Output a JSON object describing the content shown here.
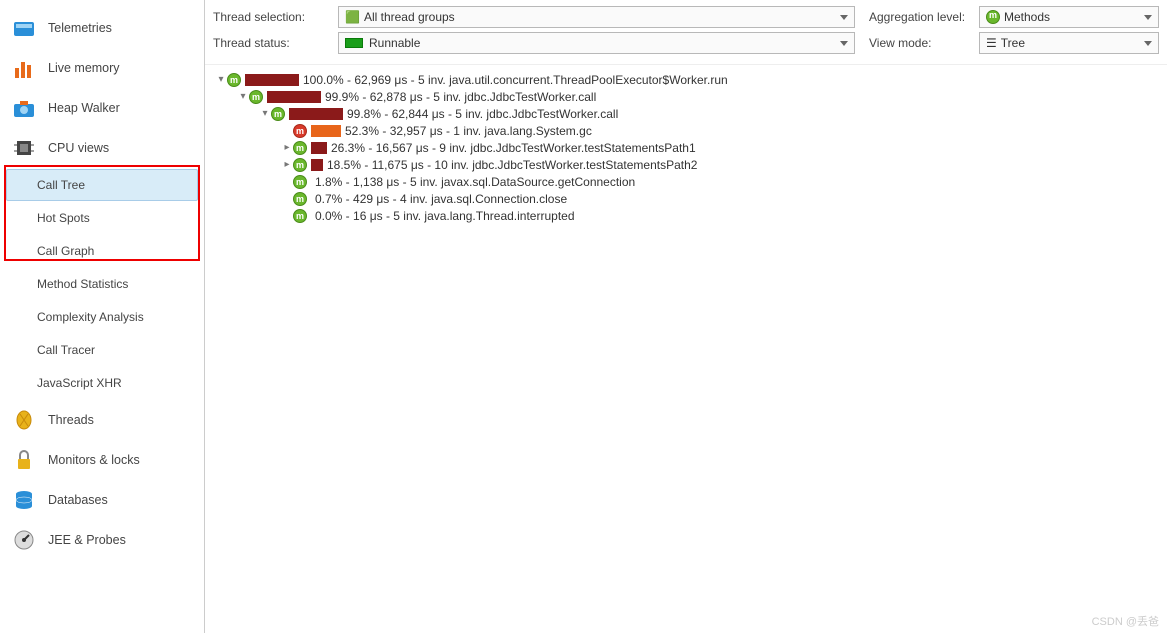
{
  "sidebar": {
    "items": [
      {
        "label": "Telemetries"
      },
      {
        "label": "Live memory"
      },
      {
        "label": "Heap Walker"
      },
      {
        "label": "CPU views"
      },
      {
        "label": "Threads"
      },
      {
        "label": "Monitors & locks"
      },
      {
        "label": "Databases"
      },
      {
        "label": "JEE & Probes"
      }
    ],
    "cpu_sub": [
      {
        "label": "Call Tree",
        "selected": true
      },
      {
        "label": "Hot Spots"
      },
      {
        "label": "Call Graph"
      },
      {
        "label": "Method Statistics"
      },
      {
        "label": "Complexity Analysis"
      },
      {
        "label": "Call Tracer"
      },
      {
        "label": "JavaScript XHR"
      }
    ]
  },
  "filters": {
    "thread_selection_label": "Thread selection:",
    "thread_selection_value": "All thread groups",
    "thread_status_label": "Thread status:",
    "thread_status_value": "Runnable",
    "aggregation_label": "Aggregation level:",
    "aggregation_value": "Methods",
    "view_mode_label": "View mode:",
    "view_mode_value": "Tree"
  },
  "tree": [
    {
      "indent": 0,
      "expander": "▾",
      "color": "green",
      "bar": 54,
      "barClass": "bar-dark",
      "text": "100.0% - 62,969 μs - 5 inv. java.util.concurrent.ThreadPoolExecutor$Worker.run"
    },
    {
      "indent": 1,
      "expander": "▾",
      "color": "green",
      "bar": 54,
      "barClass": "bar-dark",
      "text": "99.9% - 62,878 μs - 5 inv. jdbc.JdbcTestWorker.call"
    },
    {
      "indent": 2,
      "expander": "▾",
      "color": "green",
      "bar": 54,
      "barClass": "bar-dark",
      "text": "99.8% - 62,844 μs - 5 inv. jdbc.JdbcTestWorker.call"
    },
    {
      "indent": 3,
      "expander": "",
      "color": "red",
      "bar": 30,
      "barClass": "bar-orange",
      "text": "52.3% - 32,957 μs - 1 inv. java.lang.System.gc"
    },
    {
      "indent": 3,
      "expander": "▸",
      "color": "green",
      "bar": 16,
      "barClass": "bar-dark",
      "text": "26.3% - 16,567 μs - 9 inv. jdbc.JdbcTestWorker.testStatementsPath1"
    },
    {
      "indent": 3,
      "expander": "▸",
      "color": "green",
      "bar": 12,
      "barClass": "bar-dark",
      "text": "18.5% - 11,675 μs - 10 inv. jdbc.JdbcTestWorker.testStatementsPath2"
    },
    {
      "indent": 3,
      "expander": "",
      "color": "green",
      "bar": 0,
      "barClass": "bar-dark",
      "text": "1.8% - 1,138 μs - 5 inv. javax.sql.DataSource.getConnection"
    },
    {
      "indent": 3,
      "expander": "",
      "color": "green",
      "bar": 0,
      "barClass": "bar-dark",
      "text": "0.7% - 429 μs - 4 inv. java.sql.Connection.close"
    },
    {
      "indent": 3,
      "expander": "",
      "color": "green",
      "bar": 0,
      "barClass": "bar-dark",
      "text": "0.0% - 16 μs - 5 inv. java.lang.Thread.interrupted"
    }
  ],
  "watermark": "CSDN @丢爸"
}
